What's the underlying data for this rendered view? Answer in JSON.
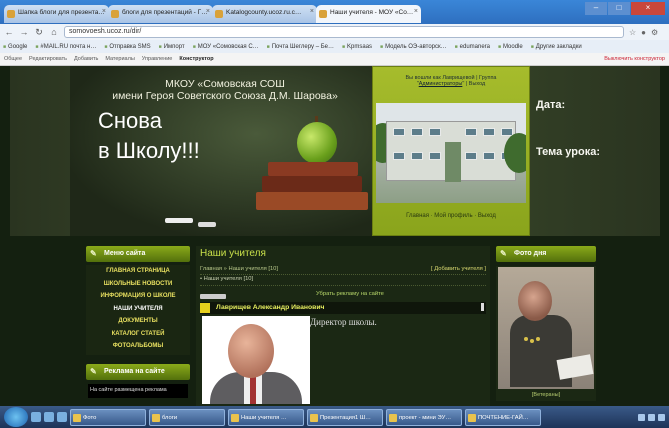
{
  "browser": {
    "tabs": [
      {
        "label": "Шапка блоги для презента…"
      },
      {
        "label": "блоги для презентаций - Г…"
      },
      {
        "label": "Katalogcounty.ucoz.ru.c…"
      },
      {
        "label": "Наши учителя - МОУ «Со…",
        "active": true
      }
    ],
    "url": "somovoesh.ucoz.ru/dir/",
    "bookmarks": [
      "Google",
      "#MAIL.RU почта н…",
      "Отправка SMS",
      "Импорт",
      "МОУ «Сомовская С…",
      "Почта Шеглеру – Бе…",
      "Kpmsaas",
      "Модель ОЭ-авторск…",
      "edumanera",
      "Moodle",
      "Другие закладки"
    ],
    "ucoz_bar": [
      "Общее",
      "Редактировать",
      "Добавить",
      "Материалы",
      "Управление",
      "Конструктор"
    ],
    "ucoz_right": "Выключить конструктор"
  },
  "banner": {
    "school_line1": "МКОУ «Сомовская СОШ",
    "school_line2": "имени Героя Советского Союза Д.М. Шарова»",
    "slogan_line1": "Снова",
    "slogan_line2": "в Школу!!!",
    "photo_top_text": "Вы вошли как Лаврищевой | Группа",
    "photo_top_link": "Администраторы",
    "photo_top_exit": "Выход",
    "photo_links": "Главная · Мой профиль · Выход",
    "date_label": "Дата:",
    "topic_label": "Тема урока:"
  },
  "menu": {
    "header": "Меню сайта",
    "items": [
      {
        "label": "Главная страница"
      },
      {
        "label": "Школьные новости"
      },
      {
        "label": "Информация о школе"
      },
      {
        "label": "Наши учителя",
        "active": true
      },
      {
        "label": "Документы"
      },
      {
        "label": "Каталог статей"
      },
      {
        "label": "Фотоальбомы"
      }
    ]
  },
  "ads_block": {
    "header": "Реклама на сайте",
    "text": "На сайте размещена реклама"
  },
  "main": {
    "title": "Наши учителя",
    "breadcrumb": "Главная » Наши учителя [10]",
    "add_link": "[ Добавить учителя ]",
    "dropdown": "Наши учителя [10]",
    "remove_ads": "Убрать рекламу на сайте",
    "entry_name": "Лаврищев Александр Иванович",
    "entry_position": "Директор школы."
  },
  "photo_of_day": {
    "header": "Фото дня",
    "caption": "[Ветераны]"
  },
  "taskbar": {
    "tasks": [
      "Фото",
      "блоги",
      "Наши учителя …",
      "Презентация1 Ш…",
      "проект - мини ЭУ…",
      "ПОЧТЕНИЕ-ГАЙ…"
    ]
  }
}
